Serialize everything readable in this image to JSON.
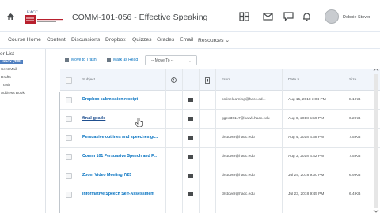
{
  "header": {
    "course_title": "COMM-101-056 - Effective Speaking",
    "user_name": "Debbie Stover",
    "logo_text": "HACC"
  },
  "nav": {
    "items": [
      "Course Home",
      "Content",
      "Discussions",
      "Dropbox",
      "Quizzes",
      "Grades",
      "Email",
      "Resources ⌄"
    ]
  },
  "sidebar": {
    "title": "er List",
    "items": [
      "Inbox (388)",
      "Sent Mail",
      "Drafts",
      "Trash",
      "Address Book"
    ]
  },
  "toolbar": {
    "move_to_trash": "Move to Trash",
    "mark_as_read": "Mark as Read",
    "move_to_placeholder": "-- Move To --"
  },
  "table": {
    "headers": {
      "subject": "Subject",
      "from": "From",
      "date": "Date ▾",
      "size": "Size"
    },
    "rows": [
      {
        "subject": "Dropbox submission receipt",
        "from": "onlinelearning@hacc.ed...",
        "date": "Aug 15, 2018 3:04 PM",
        "size": "8.1 KB"
      },
      {
        "subject": "final grade",
        "from": "ggeo30117@hawk.hacc.edu",
        "date": "Aug 6, 2018 5:59 PM",
        "size": "6.2 KB"
      },
      {
        "subject": "Persuasive outlines and speeches gr...",
        "from": "drstover@hacc.edu",
        "date": "Aug 4, 2018 4:38 PM",
        "size": "7.5 KB"
      },
      {
        "subject": "Comm 101 Persuasive Speech and F...",
        "from": "drstover@hacc.edu",
        "date": "Aug 3, 2018 4:42 PM",
        "size": "7.5 KB"
      },
      {
        "subject": "Zoom Video Meeting 7/25",
        "from": "drstover@hacc.edu",
        "date": "Jul 24, 2018 9:00 PM",
        "size": "6.9 KB"
      },
      {
        "subject": "Informative Speech Self-Assessment",
        "from": "drstover@hacc.edu",
        "date": "Jul 23, 2018 9:45 PM",
        "size": "6.4 KB"
      }
    ]
  },
  "colors": {
    "link": "#006fbf",
    "header_bg": "#f1f5fb",
    "active_sidebar": "#4f7fc0"
  }
}
